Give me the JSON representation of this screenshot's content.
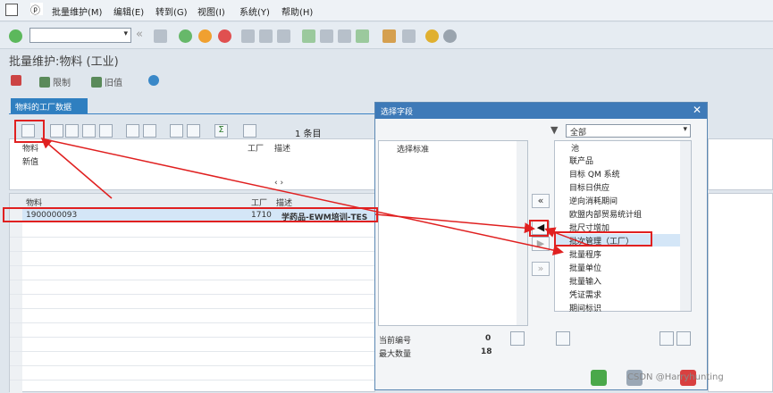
{
  "menu": {
    "items": [
      "批量维护(M)",
      "编辑(E)",
      "转到(G)",
      "视图(I)",
      "系统(Y)",
      "帮助(H)"
    ]
  },
  "title": "批量维护:物料 (工业)",
  "appbar": {
    "limit_label": "限制",
    "old_value_label": "旧值"
  },
  "tab": {
    "label": "物料的工厂数据"
  },
  "grid": {
    "count_text": "1 条目",
    "filter_headers": {
      "material": "物料",
      "plant": "工厂",
      "desc": "描述",
      "new_value": "新值"
    },
    "table_headers": {
      "material": "物料",
      "plant": "工厂",
      "desc": "描述"
    },
    "rows": [
      {
        "material": "1900000093",
        "plant": "1710",
        "desc": "学药品-EWM培训-TES"
      }
    ]
  },
  "dialog": {
    "title": "选择字段",
    "left_header": "选择标准",
    "dropdown_value": "全部",
    "pool_header": "池",
    "pool_items": [
      "联产品",
      "目标 QM 系统",
      "目标日供应",
      "逆向消耗期间",
      "欧盟内部贸易统计组",
      "批尺寸增加",
      "批次管理（工厂）",
      "批量程序",
      "批量单位",
      "批量输入",
      "凭证需求",
      "期间标识"
    ],
    "current_number_label": "当前编号",
    "current_number_value": "0",
    "max_count_label": "最大数量",
    "max_count_value": "18"
  },
  "watermark": "CSDN @Harryhunting",
  "colors": {
    "accent": "#3e7ab8",
    "highlight": "#e02020",
    "selected_row": "#d4e6f7"
  }
}
